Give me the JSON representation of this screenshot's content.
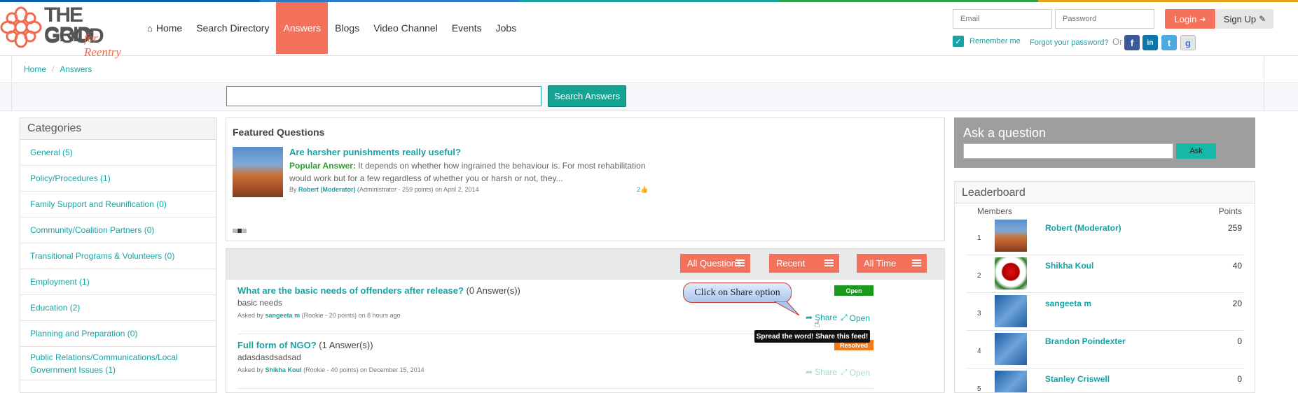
{
  "topbar_colors": [
    "#0b5fa8",
    "#2a7bc5",
    "#1aa0a0",
    "#2fa04a",
    "#e8a21a"
  ],
  "brand": {
    "line1": "THE GOOD",
    "line2": "GRID",
    "tagline": "for Reentry",
    "accent": "#f4715b",
    "teal": "#16a3a3"
  },
  "nav": {
    "items": [
      {
        "label": "Home",
        "icon": "home-icon"
      },
      {
        "label": "Search Directory"
      },
      {
        "label": "Answers",
        "active": true
      },
      {
        "label": "Blogs"
      },
      {
        "label": "Video Channel"
      },
      {
        "label": "Events"
      },
      {
        "label": "Jobs"
      }
    ]
  },
  "auth": {
    "email_placeholder": "Email",
    "password_placeholder": "Password",
    "login_label": "Login",
    "signup_label": "Sign Up",
    "remember_label": "Remember me",
    "forgot_label": "Forgot your password?",
    "or_label": "Or",
    "social": [
      "f",
      "in",
      "t",
      "g"
    ]
  },
  "breadcrumb": {
    "home": "Home",
    "current": "Answers"
  },
  "search": {
    "button_label": "Search Answers"
  },
  "categories": {
    "title": "Categories",
    "items": [
      "General (5)",
      "Policy/Procedures (1)",
      "Family Support and Reunification (0)",
      "Community/Coalition Partners (0)",
      "Transitional Programs & Volunteers (0)",
      "Employment (1)",
      "Education (2)",
      "Planning and Preparation (0)",
      "Public Relations/Communications/Local Government Issues (1)"
    ]
  },
  "featured": {
    "title": "Featured Questions",
    "question": "Are harsher punishments really useful?",
    "answer_label": "Popular Answer:",
    "answer_text": "It depends on whether how ingrained the behaviour is. For most rehabilitation would work but for a few regardless of whether you or harsh or not, they...",
    "by": "By",
    "author": "Robert (Moderator)",
    "author_meta": "(Administrator - 259 points)  on April 2, 2014",
    "likes": "2"
  },
  "filters": {
    "all": "All Questions",
    "recent": "Recent",
    "time": "All Time"
  },
  "questions": [
    {
      "title": "What are the basic needs of offenders after release?",
      "answers": "(0 Answer(s))",
      "desc": "basic needs",
      "asked_by": "Asked by",
      "user": "sangeeta m",
      "meta": "(Rookie - 20 points)  on 8 hours ago",
      "status": "Open",
      "status_color": "#1a9a1a",
      "share": "Share",
      "open": "Open"
    },
    {
      "title": "Full form of NGO?",
      "answers": "(1 Answer(s))",
      "desc": "adasdasdsadsad",
      "asked_by": "Asked by",
      "user": "Shikha Koul",
      "meta": "(Rookie - 40 points)  on December 15, 2014",
      "status": "Resolved",
      "status_color": "#f07a1a",
      "share": "Share",
      "open": "Open"
    }
  ],
  "callout": "Click on Share option",
  "tooltip": "Spread the word! Share this feed!",
  "ask": {
    "title": "Ask a question",
    "button": "Ask"
  },
  "leaderboard": {
    "title": "Leaderboard",
    "col_members": "Members",
    "col_points": "Points",
    "rows": [
      {
        "rank": "1",
        "name": "Robert (Moderator)",
        "points": "259",
        "avatar": "canyon"
      },
      {
        "rank": "2",
        "name": "Shikha Koul",
        "points": "40",
        "avatar": "rose"
      },
      {
        "rank": "3",
        "name": "sangeeta m",
        "points": "20",
        "avatar": "blue"
      },
      {
        "rank": "4",
        "name": "Brandon Poindexter",
        "points": "0",
        "avatar": "blue"
      },
      {
        "rank": "5",
        "name": "Stanley Criswell",
        "points": "0",
        "avatar": "blue"
      }
    ]
  }
}
